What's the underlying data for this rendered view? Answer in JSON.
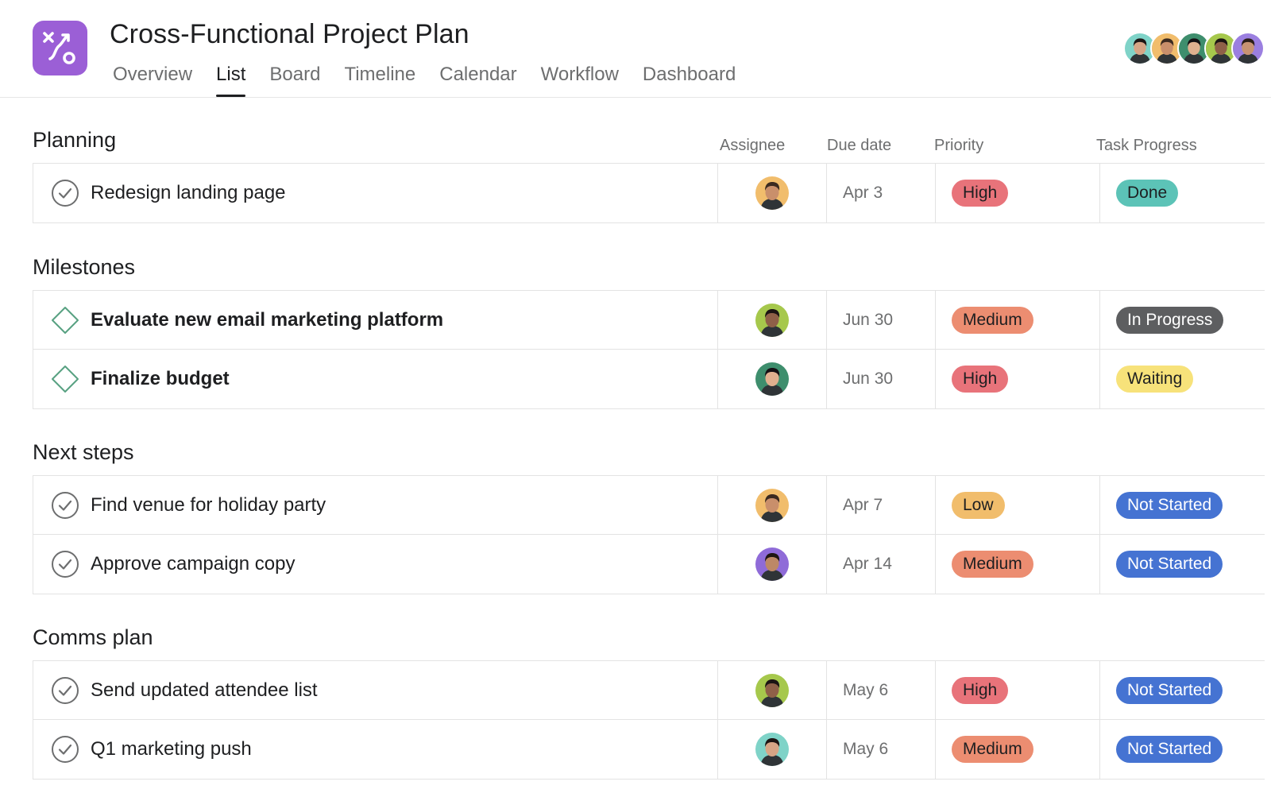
{
  "project": {
    "title": "Cross-Functional Project Plan",
    "icon": "project-path-icon",
    "icon_color": "#9b5fd6"
  },
  "tabs": [
    {
      "label": "Overview",
      "active": false
    },
    {
      "label": "List",
      "active": true
    },
    {
      "label": "Board",
      "active": false
    },
    {
      "label": "Timeline",
      "active": false
    },
    {
      "label": "Calendar",
      "active": false
    },
    {
      "label": "Workflow",
      "active": false
    },
    {
      "label": "Dashboard",
      "active": false
    }
  ],
  "members": [
    "p6",
    "p1",
    "p3",
    "p2",
    "p5"
  ],
  "columns": {
    "assignee": "Assignee",
    "due_date": "Due date",
    "priority": "Priority",
    "task_progress": "Task Progress"
  },
  "colors": {
    "High": {
      "bg": "#e8737a",
      "fg": "#1e1f21"
    },
    "Medium": {
      "bg": "#ec8d71",
      "fg": "#1e1f21"
    },
    "Low": {
      "bg": "#f1bd6c",
      "fg": "#1e1f21"
    },
    "Done": {
      "bg": "#5cc3b7",
      "fg": "#1e1f21"
    },
    "In Progress": {
      "bg": "#5d5e60",
      "fg": "#ffffff"
    },
    "Waiting": {
      "bg": "#f7e27a",
      "fg": "#1e1f21"
    },
    "Not Started": {
      "bg": "#4573d2",
      "fg": "#ffffff"
    }
  },
  "people": {
    "p1": {
      "bg": "#f1bd6c",
      "skin": "#c98f6b",
      "hair": "#3b2a20"
    },
    "p2": {
      "bg": "#a6c84c",
      "skin": "#8f6048",
      "hair": "#1b1413"
    },
    "p3": {
      "bg": "#3e8e6d",
      "skin": "#e0b08f",
      "hair": "#141014"
    },
    "p4": {
      "bg": "#8f6bd8",
      "skin": "#bd8866",
      "hair": "#1f1612"
    },
    "p5": {
      "bg": "#9b7fe0",
      "skin": "#c79372",
      "hair": "#2a1d17"
    },
    "p6": {
      "bg": "#7fd3c8",
      "skin": "#d7a586",
      "hair": "#1d1514"
    }
  },
  "sections": [
    {
      "title": "Planning",
      "tasks": [
        {
          "name": "Redesign landing page",
          "type": "task",
          "icon": "check-circle-icon",
          "assignee": "p1",
          "due": "Apr 3",
          "priority": "High",
          "progress": "Done"
        }
      ]
    },
    {
      "title": "Milestones",
      "tasks": [
        {
          "name": "Evaluate new email marketing platform",
          "type": "milestone",
          "icon": "milestone-diamond-icon",
          "assignee": "p2",
          "due": "Jun 30",
          "priority": "Medium",
          "progress": "In Progress"
        },
        {
          "name": "Finalize budget",
          "type": "milestone",
          "icon": "milestone-diamond-icon",
          "assignee": "p3",
          "due": "Jun 30",
          "priority": "High",
          "progress": "Waiting"
        }
      ]
    },
    {
      "title": "Next steps",
      "tasks": [
        {
          "name": "Find venue for holiday party",
          "type": "task",
          "icon": "check-circle-icon",
          "assignee": "p1",
          "due": "Apr 7",
          "priority": "Low",
          "progress": "Not Started"
        },
        {
          "name": "Approve campaign copy",
          "type": "task",
          "icon": "check-circle-icon",
          "assignee": "p4",
          "due": "Apr 14",
          "priority": "Medium",
          "progress": "Not Started"
        }
      ]
    },
    {
      "title": "Comms plan",
      "tasks": [
        {
          "name": "Send updated attendee list",
          "type": "task",
          "icon": "check-circle-icon",
          "assignee": "p2",
          "due": "May 6",
          "priority": "High",
          "progress": "Not Started"
        },
        {
          "name": "Q1 marketing push",
          "type": "task",
          "icon": "check-circle-icon",
          "assignee": "p6",
          "due": "May 6",
          "priority": "Medium",
          "progress": "Not Started"
        }
      ]
    }
  ]
}
